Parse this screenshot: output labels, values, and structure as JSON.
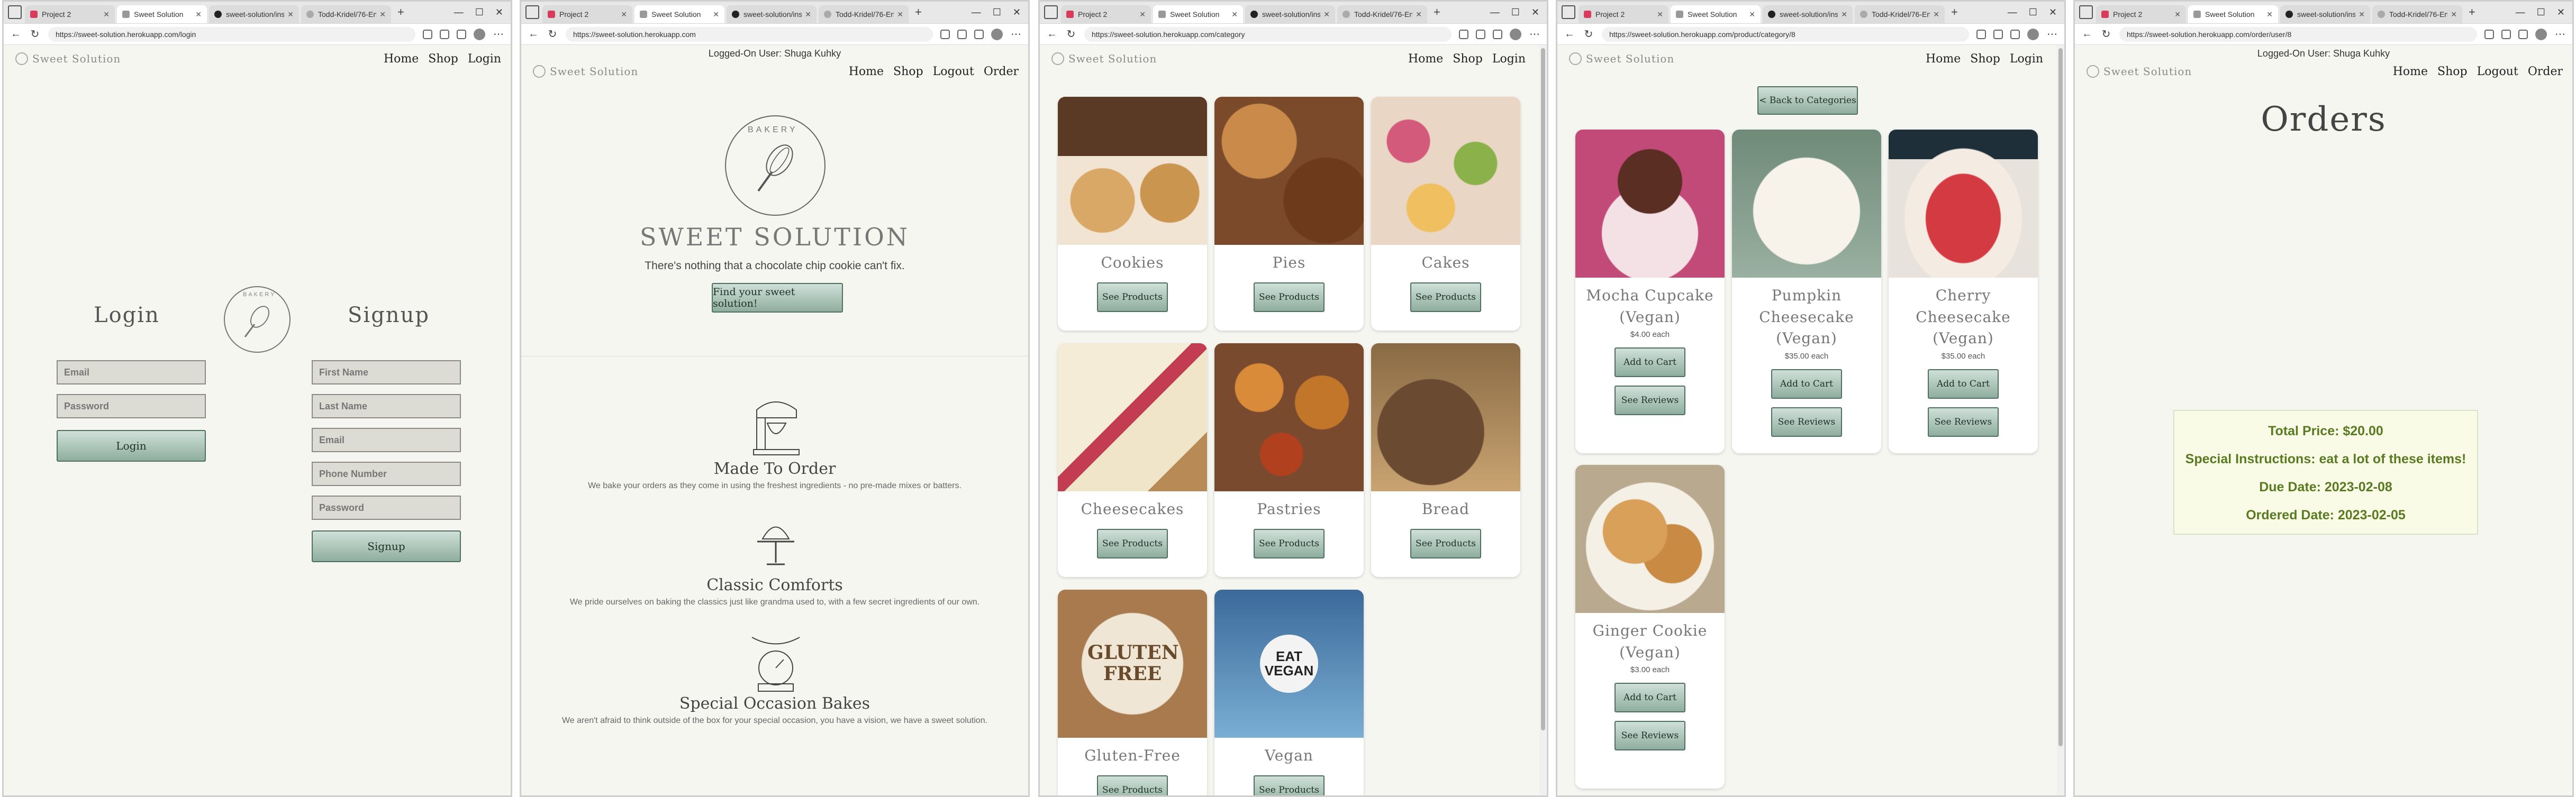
{
  "tabs": {
    "w1": [
      "Project 2",
      "Sweet Solution",
      "sweet-solution/inst...",
      "Todd-Kridel/76-Engi..."
    ],
    "w2": [
      "Project 2",
      "Sweet Solution",
      "sweet-solution/inst...",
      "Todd-Kridel/76-Engi..."
    ],
    "w3": [
      "Project 2",
      "Sweet Solution",
      "sweet-solution/inst...",
      "Todd-Kridel/76-Engi..."
    ],
    "w4": [
      "Project 2",
      "Sweet Solution",
      "sweet-solution/inst...",
      "Todd-Kridel/76-Engi..."
    ],
    "w5": [
      "Project 2",
      "Sweet Solution",
      "sweet-solution/inst...",
      "Todd-Kridel/76-Engi..."
    ]
  },
  "urls": {
    "login": "https://sweet-solution.herokuapp.com/login",
    "home": "https://sweet-solution.herokuapp.com",
    "category": "https://sweet-solution.herokuapp.com/category",
    "product": "https://sweet-solution.herokuapp.com/product/category/8",
    "orders": "https://sweet-solution.herokuapp.com/order/user/8"
  },
  "brand": "Sweet Solution",
  "nav": {
    "home": "Home",
    "shop": "Shop",
    "login": "Login",
    "logout": "Logout",
    "order": "Order"
  },
  "loggedon": "Logged-On User: Shuga Kuhky",
  "login_page": {
    "login_title": "Login",
    "signup_title": "Signup",
    "email_ph": "Email",
    "password_ph": "Password",
    "login_btn": "Login",
    "first_ph": "First Name",
    "last_ph": "Last Name",
    "phone_ph": "Phone Number",
    "signup_btn": "Signup",
    "badge_text": "BAKERY"
  },
  "home_page": {
    "badge_text": "BAKERY",
    "title": "SWEET SOLUTION",
    "tagline": "There's nothing that a chocolate chip cookie can't fix.",
    "cta": "Find your sweet solution!",
    "features": [
      {
        "title": "Made To Order",
        "desc": "We bake your orders as they come in using the freshest ingredients - no pre-made mixes or batters."
      },
      {
        "title": "Classic Comforts",
        "desc": "We pride ourselves on baking the classics just like grandma used to, with a few secret ingredients of our own."
      },
      {
        "title": "Special Occasion Bakes",
        "desc": "We aren't afraid to think outside of the box for your special occasion, you have a vision, we have a sweet solution."
      }
    ]
  },
  "category_page": {
    "see_products": "See Products",
    "categories": [
      "Cookies",
      "Pies",
      "Cakes",
      "Cheesecakes",
      "Pastries",
      "Bread",
      "Gluten-Free",
      "Vegan"
    ],
    "image_text": {
      "gluten": "GLUTEN FREE",
      "vegan": "EAT VEGAN"
    }
  },
  "product_page": {
    "back": "< Back to Categories",
    "add_cart": "Add to Cart",
    "see_reviews": "See Reviews",
    "products": [
      {
        "name": "Mocha Cupcake (Vegan)",
        "price": "$4.00 each"
      },
      {
        "name": "Pumpkin Cheesecake (Vegan)",
        "price": "$35.00 each"
      },
      {
        "name": "Cherry Cheesecake (Vegan)",
        "price": "$35.00 each"
      },
      {
        "name": "Ginger Cookie (Vegan)",
        "price": "$3.00 each"
      }
    ]
  },
  "orders_page": {
    "title": "Orders",
    "total": "Total Price: $20.00",
    "instructions": "Special Instructions: eat a lot of these items!",
    "due": "Due Date: 2023-02-08",
    "ordered": "Ordered Date: 2023-02-05"
  },
  "colors": {
    "page_bg": "#f6f6f1",
    "button_top": "#cfe0d8",
    "button_bottom": "#8fae9f",
    "order_text": "#5a7a22"
  }
}
